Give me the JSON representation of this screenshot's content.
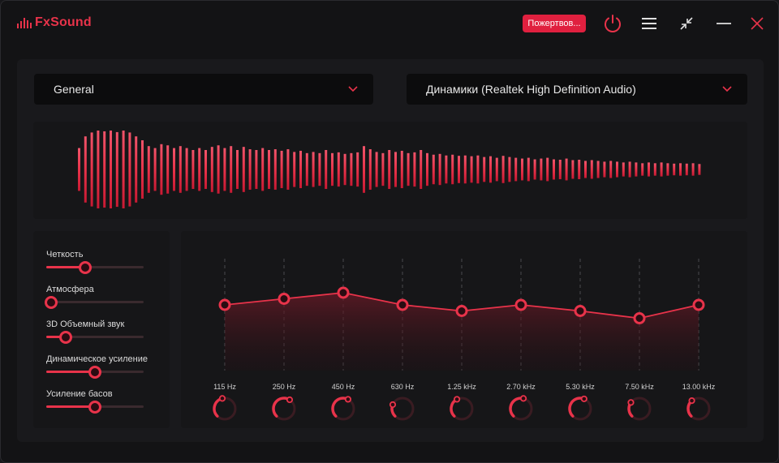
{
  "app": {
    "name": "FxSound",
    "donate_label": "Пожертвов...",
    "accent": "#e8334a"
  },
  "presets": {
    "selected": "General"
  },
  "output": {
    "selected": "Динамики (Realtek High Definition Audio)"
  },
  "visualizer": {
    "levels": [
      0.55,
      0.85,
      0.95,
      1.0,
      0.98,
      1.0,
      0.96,
      1.0,
      0.95,
      0.85,
      0.75,
      0.6,
      0.55,
      0.65,
      0.62,
      0.55,
      0.6,
      0.55,
      0.5,
      0.55,
      0.5,
      0.58,
      0.62,
      0.55,
      0.6,
      0.5,
      0.58,
      0.52,
      0.5,
      0.55,
      0.5,
      0.52,
      0.48,
      0.52,
      0.45,
      0.48,
      0.42,
      0.45,
      0.42,
      0.5,
      0.42,
      0.44,
      0.4,
      0.42,
      0.44,
      0.6,
      0.52,
      0.45,
      0.42,
      0.5,
      0.45,
      0.48,
      0.42,
      0.44,
      0.5,
      0.42,
      0.38,
      0.4,
      0.36,
      0.38,
      0.35,
      0.36,
      0.34,
      0.36,
      0.32,
      0.34,
      0.3,
      0.35,
      0.32,
      0.3,
      0.28,
      0.3,
      0.26,
      0.28,
      0.3,
      0.26,
      0.25,
      0.28,
      0.24,
      0.25,
      0.22,
      0.24,
      0.22,
      0.2,
      0.22,
      0.2,
      0.18,
      0.2,
      0.18,
      0.16,
      0.18,
      0.16,
      0.18,
      0.16,
      0.15,
      0.16,
      0.15,
      0.16,
      0.14
    ]
  },
  "effects": [
    {
      "label": "Четкость",
      "value": 0.4
    },
    {
      "label": "Атмосфера",
      "value": 0.0
    },
    {
      "label": "3D Объемный звук",
      "value": 0.2
    },
    {
      "label": "Динамическое усиление",
      "value": 0.5
    },
    {
      "label": "Усиление басов",
      "value": 0.5
    }
  ],
  "eq": {
    "bands": [
      {
        "freq": "115 Hz",
        "level": 0.62
      },
      {
        "freq": "250 Hz",
        "level": 0.67
      },
      {
        "freq": "450 Hz",
        "level": 0.72
      },
      {
        "freq": "630 Hz",
        "level": 0.62
      },
      {
        "freq": "1.25 kHz",
        "level": 0.57
      },
      {
        "freq": "2.70 kHz",
        "level": 0.62
      },
      {
        "freq": "5.30 kHz",
        "level": 0.57
      },
      {
        "freq": "7.50 kHz",
        "level": 0.51
      },
      {
        "freq": "13.00 kHz",
        "level": 0.62
      }
    ],
    "knob_values": [
      0.45,
      0.62,
      0.6,
      0.25,
      0.4,
      0.55,
      0.58,
      0.3,
      0.35
    ]
  }
}
